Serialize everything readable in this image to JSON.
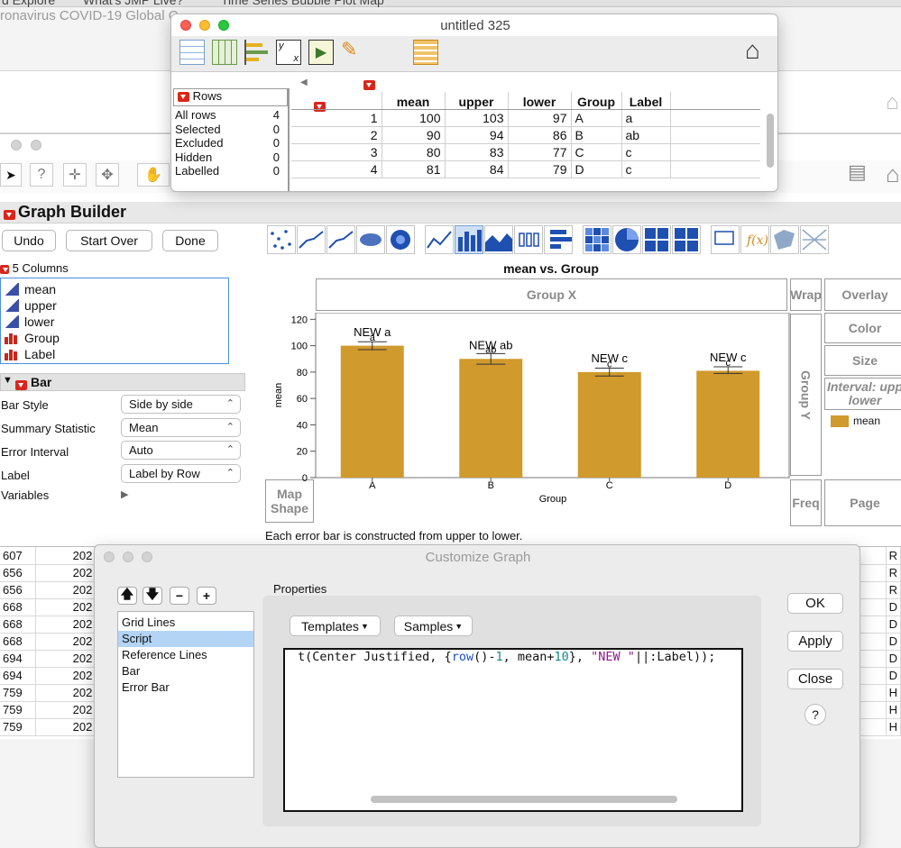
{
  "bg_tabs": [
    "d Explore",
    "What's JMP Live?",
    "Time Series Bubble Plot Map"
  ],
  "bg_title": "ronavirus COVID-19 Global C",
  "bg_rows": [
    {
      "a": "607",
      "b": "202",
      "c": "R"
    },
    {
      "a": "656",
      "b": "202",
      "c": "R"
    },
    {
      "a": "656",
      "b": "202",
      "c": "R"
    },
    {
      "a": "668",
      "b": "202",
      "c": "D"
    },
    {
      "a": "668",
      "b": "202",
      "c": "D"
    },
    {
      "a": "668",
      "b": "202",
      "c": "D"
    },
    {
      "a": "694",
      "b": "202",
      "c": "D"
    },
    {
      "a": "694",
      "b": "202",
      "c": "D"
    },
    {
      "a": "759",
      "b": "202",
      "c": "H"
    },
    {
      "a": "759",
      "b": "202",
      "c": "H"
    },
    {
      "a": "759",
      "b": "202",
      "c": "H"
    }
  ],
  "data_table": {
    "title": "untitled 325",
    "rows_header": "Rows",
    "row_states": [
      {
        "label": "All rows",
        "count": "4"
      },
      {
        "label": "Selected",
        "count": "0"
      },
      {
        "label": "Excluded",
        "count": "0"
      },
      {
        "label": "Hidden",
        "count": "0"
      },
      {
        "label": "Labelled",
        "count": "0"
      }
    ],
    "columns": [
      "mean",
      "upper",
      "lower",
      "Group",
      "Label"
    ],
    "rows": [
      {
        "n": "1",
        "mean": "100",
        "upper": "103",
        "lower": "97",
        "group": "A",
        "label": "a"
      },
      {
        "n": "2",
        "mean": "90",
        "upper": "94",
        "lower": "86",
        "group": "B",
        "label": "ab"
      },
      {
        "n": "3",
        "mean": "80",
        "upper": "83",
        "lower": "77",
        "group": "C",
        "label": "c"
      },
      {
        "n": "4",
        "mean": "81",
        "upper": "84",
        "lower": "79",
        "group": "D",
        "label": "c"
      }
    ]
  },
  "graph_builder": {
    "title": "Graph Builder",
    "undo": "Undo",
    "start_over": "Start Over",
    "done": "Done",
    "columns_header": "5 Columns",
    "columns": [
      {
        "name": "mean",
        "type": "continuous"
      },
      {
        "name": "upper",
        "type": "continuous"
      },
      {
        "name": "lower",
        "type": "continuous"
      },
      {
        "name": "Group",
        "type": "nominal"
      },
      {
        "name": "Label",
        "type": "nominal"
      }
    ],
    "bar_header": "Bar",
    "props": [
      {
        "label": "Bar Style",
        "value": "Side by side"
      },
      {
        "label": "Summary Statistic",
        "value": "Mean"
      },
      {
        "label": "Error Interval",
        "value": "Auto"
      },
      {
        "label": "Label",
        "value": "Label by Row"
      }
    ],
    "variables_label": "Variables",
    "zones": {
      "group_x": "Group X",
      "wrap": "Wrap",
      "overlay": "Overlay",
      "color": "Color",
      "size": "Size",
      "interval": "Interval: upp",
      "interval2": "lower",
      "group_y": "Group Y",
      "freq": "Freq",
      "page": "Page",
      "map_shape": "Map",
      "map_shape2": "Shape"
    },
    "legend_item": "mean",
    "footnote": "Each error bar is constructed from upper to lower."
  },
  "chart_data": {
    "type": "bar",
    "title": "mean vs. Group",
    "xlabel": "Group",
    "ylabel": "mean",
    "categories": [
      "A",
      "B",
      "C",
      "D"
    ],
    "values": [
      100,
      90,
      80,
      81
    ],
    "upper": [
      103,
      94,
      83,
      84
    ],
    "lower": [
      97,
      86,
      77,
      79
    ],
    "bar_labels": [
      "NEW a",
      "NEW ab",
      "NEW c",
      "NEW c"
    ],
    "letters": [
      "a",
      "ab",
      "c",
      "c"
    ],
    "ylim": [
      0,
      125
    ],
    "yticks": [
      0,
      20,
      40,
      60,
      80,
      100,
      120
    ],
    "bar_color": "#d09a2c",
    "grid": false,
    "legend": "right"
  },
  "customize": {
    "title": "Customize Graph",
    "properties_label": "Properties",
    "list": [
      "Grid Lines",
      "Script",
      "Reference Lines",
      "Bar",
      "Error Bar"
    ],
    "selected_index": 1,
    "templates": "Templates",
    "samples": "Samples",
    "script_parts": {
      "p1": "t(Center Justified, {",
      "fn": "row",
      "p2": "()-",
      "n1": "1",
      "p3": ", mean+",
      "n2": "10",
      "p4": "}, ",
      "str": "\"NEW \"",
      "p5": "||:Label));"
    },
    "ok": "OK",
    "apply": "Apply",
    "close": "Close",
    "help": "?"
  },
  "colors": {
    "accent_red": "#d9261c",
    "selection": "#b3d4f5",
    "continuous_icon": "#3b4ea8",
    "nominal_icon": "#c8261c"
  }
}
